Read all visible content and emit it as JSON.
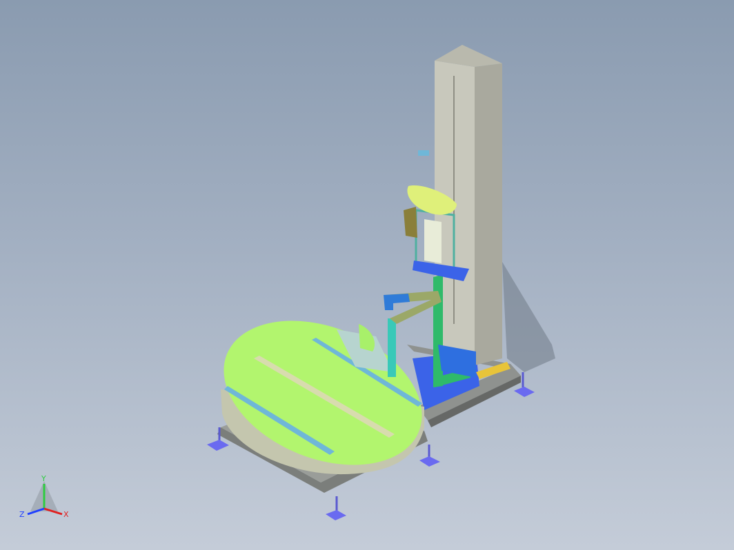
{
  "viewport": {
    "background_top": "#8a9bb0",
    "background_bottom": "#c4ccd8"
  },
  "model": {
    "colors": {
      "turntable_top": "#b2f56e",
      "turntable_side": "#c4c6ae",
      "base_frame": "#8a8d8a",
      "blue_plate": "#3b63e8",
      "mast": "#c8c8bc",
      "green_arm": "#2fba6a",
      "carriage_top": "#dff07a",
      "foot_pad": "#6a6af0",
      "rail": "#d8dcae"
    }
  },
  "triad": {
    "y_label": "Y",
    "z_label": "Z",
    "x_label": "X",
    "y_color": "#2ecc40",
    "z_color": "#1f3fff",
    "x_color": "#e02020"
  }
}
